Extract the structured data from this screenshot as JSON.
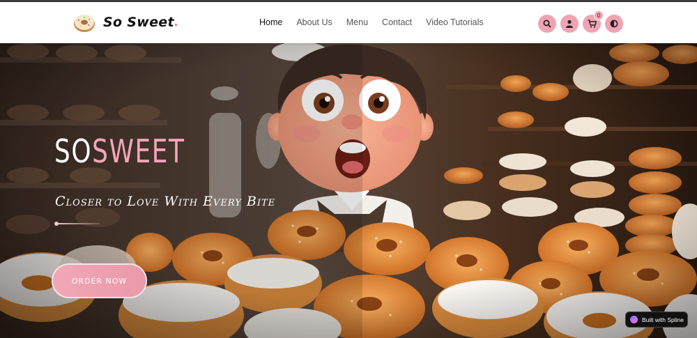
{
  "brand": {
    "name": "So Sweet",
    "dot": "."
  },
  "nav": {
    "links": [
      {
        "label": "Home",
        "active": true
      },
      {
        "label": "About Us",
        "active": false
      },
      {
        "label": "Menu",
        "active": false
      },
      {
        "label": "Contact",
        "active": false
      },
      {
        "label": "Video Tutorials",
        "active": false
      }
    ]
  },
  "icons": {
    "search": "search-icon",
    "user": "user-icon",
    "cart": "cart-icon",
    "cart_count": "0",
    "theme": "contrast-icon"
  },
  "hero": {
    "title_part1": "SO",
    "title_part2": "SWEET",
    "tagline": "Closer to Love With Every Bite",
    "cta": "ORDER NOW"
  },
  "spline_badge": "Built with Spline",
  "colors": {
    "accent_pink": "#f1a3b3",
    "title_pink": "#f4a6b9",
    "navbar_bg": "#ffffff"
  }
}
